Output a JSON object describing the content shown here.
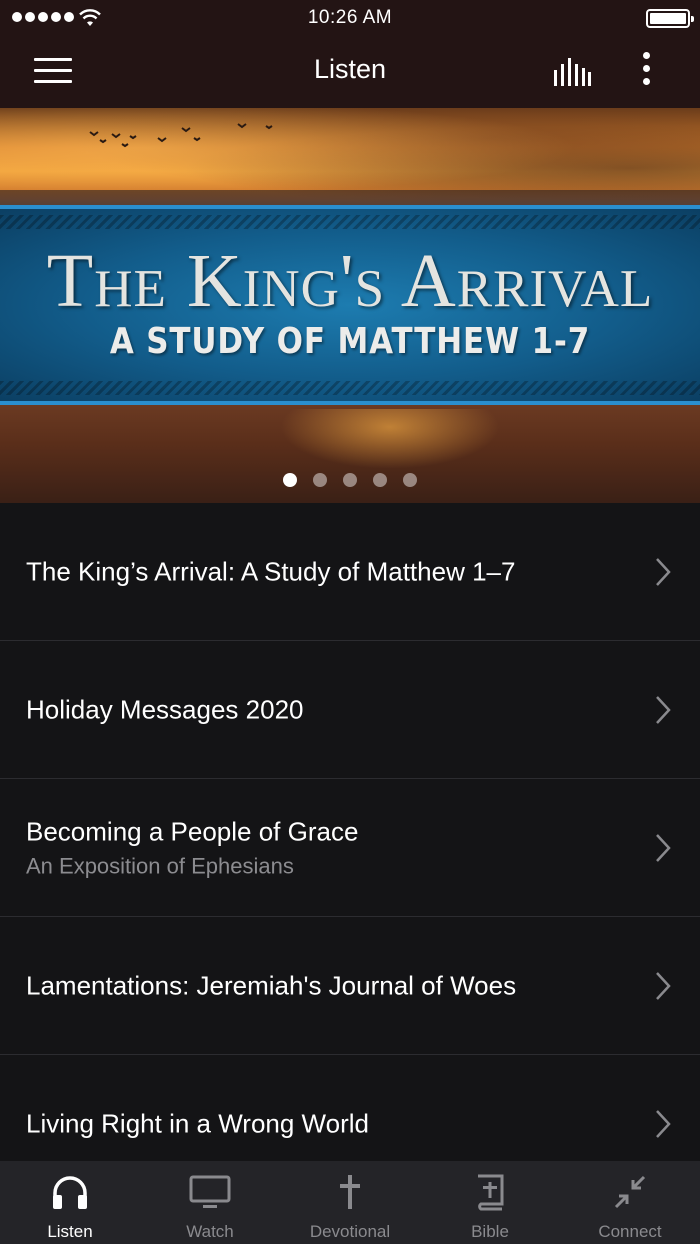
{
  "status_bar": {
    "time": "10:26 AM"
  },
  "nav": {
    "title": "Listen",
    "menu_icon": "hamburger-icon",
    "bars_icon": "audio-levels-icon",
    "more_icon": "more-vertical-icon"
  },
  "hero": {
    "title": "The King's Arrival",
    "subtitle": "A STUDY OF MATTHEW 1-7",
    "page_count": 5,
    "active_page": 1
  },
  "series": [
    {
      "title": "The King’s Arrival: A Study of Matthew 1–7",
      "subtitle": ""
    },
    {
      "title": "Holiday Messages 2020",
      "subtitle": ""
    },
    {
      "title": "Becoming a People of Grace",
      "subtitle": "An Exposition of Ephesians"
    },
    {
      "title": "Lamentations: Jeremiah's Journal of Woes",
      "subtitle": ""
    },
    {
      "title": "Living Right in a Wrong World",
      "subtitle": ""
    }
  ],
  "tabs": [
    {
      "label": "Listen",
      "icon": "headphones-icon",
      "active": true
    },
    {
      "label": "Watch",
      "icon": "monitor-icon",
      "active": false
    },
    {
      "label": "Devotional",
      "icon": "cross-icon",
      "active": false
    },
    {
      "label": "Bible",
      "icon": "bible-icon",
      "active": false
    },
    {
      "label": "Connect",
      "icon": "connect-arrows-icon",
      "active": false
    }
  ],
  "colors": {
    "nav_bg": "#231414",
    "list_bg": "#141416",
    "tab_bg": "#242428",
    "accent_blue": "#125c8a"
  }
}
